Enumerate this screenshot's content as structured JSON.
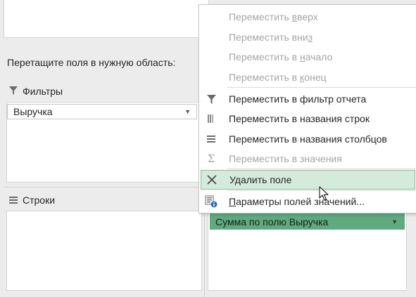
{
  "drag_hint": "Перетащите поля в нужную область:",
  "areas": {
    "filters": {
      "title": "Фильтры",
      "field": "Выручка"
    },
    "rows": {
      "title": "Строки"
    },
    "values": {
      "field": "Сумма по полю Выручка"
    }
  },
  "context_menu": {
    "items": [
      {
        "pre": "Переместить ",
        "key": "в",
        "post": "верх",
        "enabled": false,
        "icon": "none"
      },
      {
        "pre": "Переместить вни",
        "key": "з",
        "post": "",
        "enabled": false,
        "icon": "none"
      },
      {
        "pre": "Переместить в ",
        "key": "н",
        "post": "ачало",
        "enabled": false,
        "icon": "none"
      },
      {
        "pre": "Переместить в ",
        "key": "к",
        "post": "онец",
        "enabled": false,
        "icon": "none"
      },
      {
        "pre": "Переместить в фильтр отчета",
        "key": "",
        "post": "",
        "enabled": true,
        "icon": "filter-icon"
      },
      {
        "pre": "Переместить в названия строк",
        "key": "",
        "post": "",
        "enabled": true,
        "icon": "rows-icon"
      },
      {
        "pre": "Переместить в названия столбцов",
        "key": "",
        "post": "",
        "enabled": true,
        "icon": "columns-icon"
      },
      {
        "pre": "Переместить в значения",
        "key": "",
        "post": "",
        "enabled": false,
        "icon": "sigma-icon"
      },
      {
        "pre": "Удалить поле",
        "key": "",
        "post": "",
        "enabled": true,
        "icon": "remove-x-icon",
        "highlighted": true
      },
      {
        "pre": "",
        "key": "П",
        "post": "араметры полей значений...",
        "enabled": true,
        "icon": "field-settings-icon"
      }
    ]
  },
  "colors": {
    "accent_green": "#5faa7f",
    "highlight_bg": "#d4eadb",
    "highlight_border": "#86bf9c",
    "disabled_text": "#a6a6a6"
  }
}
